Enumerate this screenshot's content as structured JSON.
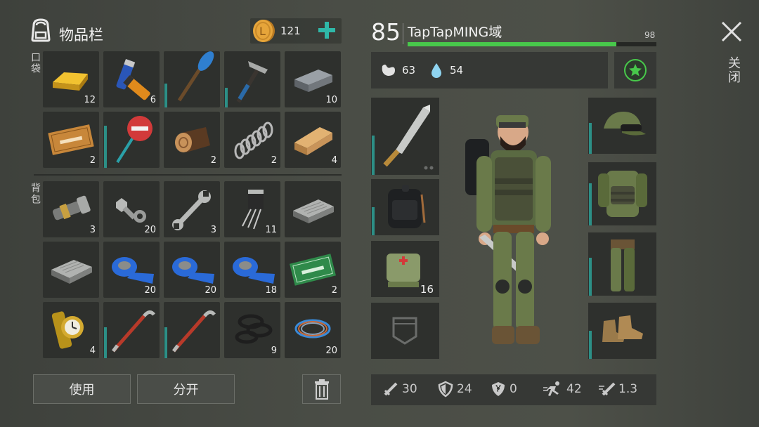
{
  "inventory": {
    "title": "物品栏",
    "coins": "121",
    "pocket_label": "口袋",
    "backpack_label": "背包",
    "pocket_items": [
      {
        "name": "gold-bar",
        "count": "12"
      },
      {
        "name": "batteries",
        "count": "6"
      },
      {
        "name": "paddle",
        "count": ""
      },
      {
        "name": "hammer",
        "count": ""
      },
      {
        "name": "iron-ingot",
        "count": "10"
      },
      {
        "name": "survival-coupon",
        "count": "2"
      },
      {
        "name": "stop-sign",
        "count": ""
      },
      {
        "name": "log",
        "count": "2"
      },
      {
        "name": "spring",
        "count": "2"
      },
      {
        "name": "plank",
        "count": "4"
      }
    ],
    "backpack_items": [
      {
        "name": "flashlight",
        "count": "3"
      },
      {
        "name": "bolts",
        "count": "20"
      },
      {
        "name": "wrench",
        "count": "3"
      },
      {
        "name": "transistor",
        "count": "11"
      },
      {
        "name": "circuit-box",
        "count": ""
      },
      {
        "name": "circuit-box-2",
        "count": ""
      },
      {
        "name": "duct-tape",
        "count": "20"
      },
      {
        "name": "duct-tape",
        "count": "20"
      },
      {
        "name": "duct-tape",
        "count": "18"
      },
      {
        "name": "ration-coupon",
        "count": "2"
      },
      {
        "name": "watch",
        "count": "4"
      },
      {
        "name": "crowbar",
        "count": ""
      },
      {
        "name": "crowbar",
        "count": ""
      },
      {
        "name": "gaskets",
        "count": "9"
      },
      {
        "name": "wire",
        "count": "20"
      }
    ],
    "use_button": "使用",
    "split_button": "分开"
  },
  "character": {
    "level": "85",
    "name": "TapTapMING域",
    "hp_max": "98",
    "hp_fraction": 0.84,
    "food": "63",
    "water": "54",
    "gear_left": [
      {
        "name": "machete",
        "count": ""
      },
      {
        "name": "backpack",
        "count": ""
      },
      {
        "name": "medkit",
        "count": "16"
      },
      {
        "name": "empty-pocket",
        "count": ""
      }
    ],
    "gear_right": [
      {
        "name": "cap-goggles",
        "count": ""
      },
      {
        "name": "armor-vest",
        "count": ""
      },
      {
        "name": "camo-pants",
        "count": ""
      },
      {
        "name": "boots",
        "count": ""
      }
    ],
    "stats": {
      "attack": "30",
      "defense": "24",
      "radiation": "0",
      "speed": "42",
      "attack_speed": "1.3"
    }
  },
  "close_label": "关闭",
  "colors": {
    "accent": "#2fb8a8",
    "hp": "#48c84b",
    "coin": "#e6a53a"
  }
}
